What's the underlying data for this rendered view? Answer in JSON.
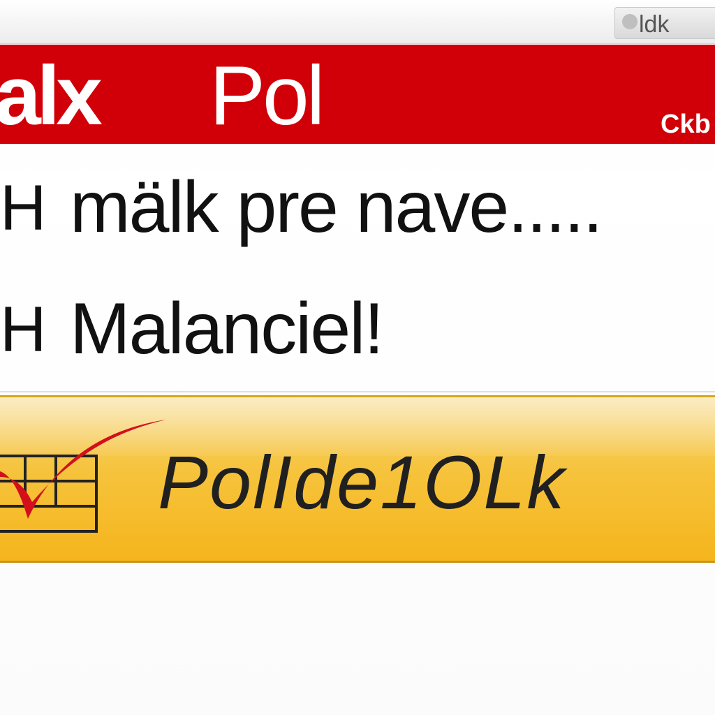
{
  "topbar": {
    "button_label": "ldk"
  },
  "header": {
    "brand": "alx",
    "title": "Pol",
    "subtitle": "Ckb"
  },
  "items": [
    {
      "marker": "H",
      "text": "mälk pre nave....."
    },
    {
      "marker": "H",
      "text": "Malanciel!"
    }
  ],
  "action_bar": {
    "text": "PolIde1OLk"
  },
  "colors": {
    "header_red": "#d10008",
    "bar_yellow": "#f5b51d",
    "check_red": "#d40f1c"
  }
}
